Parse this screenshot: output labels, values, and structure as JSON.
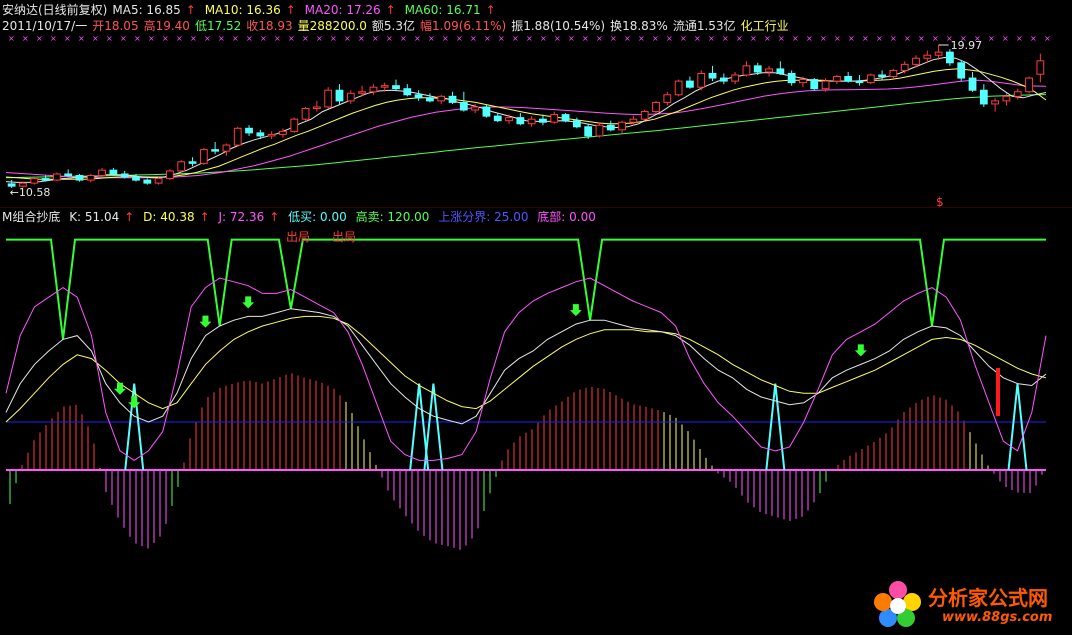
{
  "header1": {
    "title": "安纳达(日线前复权)",
    "ma5": "MA5: 16.85",
    "ma10": "MA10: 16.36",
    "ma20": "MA20: 17.26",
    "ma60": "MA60: 16.71",
    "up_arrow": "↑"
  },
  "header2": {
    "date": "2011/10/17/一",
    "open": "开18.05",
    "high": "高19.40",
    "low": "低17.52",
    "close": "收18.93",
    "volume": "量288200.0",
    "amount": "额5.3亿",
    "change": "幅1.09(6.11%)",
    "amplitude": "振1.88(10.54%)",
    "turnover": "换18.83%",
    "float_shares": "流通1.53亿",
    "industry": "化工行业"
  },
  "header3": {
    "indicator": "M组合抄底",
    "k": "K: 51.04",
    "d": "D: 40.38",
    "j": "J: 72.36",
    "low_buy": "低买: 0.00",
    "high_sell": "高卖: 120.00",
    "up_boundary": "上涨分界: 25.00",
    "bottom": "底部: 0.00"
  },
  "annotations": {
    "high_label": "19.97",
    "low_label": "10.58",
    "exit1": "出局",
    "exit2": "出局",
    "s_mark": "$"
  },
  "logo": {
    "text": "分析家公式网",
    "url": "www.88gs.com"
  },
  "colors": {
    "background": "#000000",
    "up_candle": "#ff3c3c",
    "down_candle": "#54ffff",
    "ma5": "#e6e6e6",
    "ma10": "#ffff54",
    "ma20": "#ff54ff",
    "ma60": "#54ff54",
    "top_signal": "#33ff33",
    "bottom_signal": "#54ffff",
    "boundary_line": "#2020ff",
    "zero_line": "#ff54ff"
  },
  "chart_data": {
    "type": "candlestick",
    "price_range": [
      10.58,
      19.97
    ],
    "candles": [
      {
        "o": 10.85,
        "h": 11.1,
        "l": 10.58,
        "c": 10.7
      },
      {
        "o": 10.7,
        "h": 11.0,
        "l": 10.6,
        "c": 10.9
      },
      {
        "o": 10.9,
        "h": 11.3,
        "l": 10.8,
        "c": 11.2
      },
      {
        "o": 11.2,
        "h": 11.4,
        "l": 11.0,
        "c": 11.1
      },
      {
        "o": 11.1,
        "h": 11.6,
        "l": 11.05,
        "c": 11.5
      },
      {
        "o": 11.5,
        "h": 11.8,
        "l": 11.3,
        "c": 11.4
      },
      {
        "o": 11.4,
        "h": 11.5,
        "l": 11.0,
        "c": 11.1
      },
      {
        "o": 11.1,
        "h": 11.5,
        "l": 10.95,
        "c": 11.4
      },
      {
        "o": 11.4,
        "h": 11.9,
        "l": 11.3,
        "c": 11.75
      },
      {
        "o": 11.75,
        "h": 11.9,
        "l": 11.4,
        "c": 11.5
      },
      {
        "o": 11.5,
        "h": 11.7,
        "l": 11.2,
        "c": 11.3
      },
      {
        "o": 11.3,
        "h": 11.5,
        "l": 11.0,
        "c": 11.1
      },
      {
        "o": 11.1,
        "h": 11.2,
        "l": 10.8,
        "c": 10.9
      },
      {
        "o": 10.9,
        "h": 11.3,
        "l": 10.8,
        "c": 11.2
      },
      {
        "o": 11.2,
        "h": 11.8,
        "l": 11.1,
        "c": 11.7
      },
      {
        "o": 11.7,
        "h": 12.4,
        "l": 11.6,
        "c": 12.3
      },
      {
        "o": 12.3,
        "h": 12.6,
        "l": 12.0,
        "c": 12.2
      },
      {
        "o": 12.2,
        "h": 13.2,
        "l": 12.1,
        "c": 13.1
      },
      {
        "o": 13.1,
        "h": 13.6,
        "l": 12.8,
        "c": 13.0
      },
      {
        "o": 13.0,
        "h": 13.5,
        "l": 12.7,
        "c": 13.4
      },
      {
        "o": 13.4,
        "h": 14.6,
        "l": 13.3,
        "c": 14.5
      },
      {
        "o": 14.5,
        "h": 14.7,
        "l": 14.0,
        "c": 14.2
      },
      {
        "o": 14.2,
        "h": 14.4,
        "l": 13.8,
        "c": 14.0
      },
      {
        "o": 14.0,
        "h": 14.3,
        "l": 13.8,
        "c": 14.1
      },
      {
        "o": 14.1,
        "h": 14.5,
        "l": 13.9,
        "c": 14.3
      },
      {
        "o": 14.3,
        "h": 15.2,
        "l": 14.2,
        "c": 15.1
      },
      {
        "o": 15.1,
        "h": 15.9,
        "l": 15.0,
        "c": 15.8
      },
      {
        "o": 15.8,
        "h": 16.3,
        "l": 15.6,
        "c": 15.9
      },
      {
        "o": 15.9,
        "h": 17.2,
        "l": 15.8,
        "c": 17.0
      },
      {
        "o": 17.0,
        "h": 17.4,
        "l": 16.1,
        "c": 16.3
      },
      {
        "o": 16.3,
        "h": 17.0,
        "l": 16.1,
        "c": 16.8
      },
      {
        "o": 16.8,
        "h": 17.3,
        "l": 16.6,
        "c": 16.9
      },
      {
        "o": 16.9,
        "h": 17.4,
        "l": 16.7,
        "c": 17.2
      },
      {
        "o": 17.2,
        "h": 17.5,
        "l": 16.9,
        "c": 17.3
      },
      {
        "o": 17.3,
        "h": 17.7,
        "l": 17.0,
        "c": 17.1
      },
      {
        "o": 17.1,
        "h": 17.4,
        "l": 16.6,
        "c": 16.7
      },
      {
        "o": 16.7,
        "h": 17.0,
        "l": 16.3,
        "c": 16.5
      },
      {
        "o": 16.5,
        "h": 16.8,
        "l": 16.2,
        "c": 16.3
      },
      {
        "o": 16.3,
        "h": 16.7,
        "l": 16.1,
        "c": 16.6
      },
      {
        "o": 16.6,
        "h": 16.9,
        "l": 16.1,
        "c": 16.2
      },
      {
        "o": 16.2,
        "h": 16.9,
        "l": 15.6,
        "c": 15.7
      },
      {
        "o": 15.7,
        "h": 16.1,
        "l": 15.5,
        "c": 15.9
      },
      {
        "o": 15.9,
        "h": 16.1,
        "l": 15.2,
        "c": 15.3
      },
      {
        "o": 15.3,
        "h": 15.5,
        "l": 14.9,
        "c": 15.0
      },
      {
        "o": 15.0,
        "h": 15.4,
        "l": 14.8,
        "c": 15.2
      },
      {
        "o": 15.2,
        "h": 15.5,
        "l": 14.7,
        "c": 14.8
      },
      {
        "o": 14.8,
        "h": 15.3,
        "l": 14.6,
        "c": 15.1
      },
      {
        "o": 15.1,
        "h": 15.4,
        "l": 14.7,
        "c": 14.9
      },
      {
        "o": 14.9,
        "h": 15.6,
        "l": 14.8,
        "c": 15.4
      },
      {
        "o": 15.4,
        "h": 15.5,
        "l": 14.9,
        "c": 15.0
      },
      {
        "o": 15.0,
        "h": 15.2,
        "l": 14.5,
        "c": 14.6
      },
      {
        "o": 14.6,
        "h": 14.8,
        "l": 13.8,
        "c": 14.0
      },
      {
        "o": 14.0,
        "h": 14.9,
        "l": 13.9,
        "c": 14.7
      },
      {
        "o": 14.7,
        "h": 15.0,
        "l": 14.3,
        "c": 14.4
      },
      {
        "o": 14.4,
        "h": 15.0,
        "l": 14.2,
        "c": 14.9
      },
      {
        "o": 14.9,
        "h": 15.3,
        "l": 14.7,
        "c": 15.1
      },
      {
        "o": 15.1,
        "h": 15.7,
        "l": 15.0,
        "c": 15.6
      },
      {
        "o": 15.6,
        "h": 16.3,
        "l": 15.5,
        "c": 16.2
      },
      {
        "o": 16.2,
        "h": 16.9,
        "l": 16.0,
        "c": 16.7
      },
      {
        "o": 16.7,
        "h": 17.7,
        "l": 16.6,
        "c": 17.6
      },
      {
        "o": 17.6,
        "h": 17.9,
        "l": 17.1,
        "c": 17.2
      },
      {
        "o": 17.2,
        "h": 18.3,
        "l": 17.0,
        "c": 18.1
      },
      {
        "o": 18.1,
        "h": 18.6,
        "l": 17.6,
        "c": 17.8
      },
      {
        "o": 17.8,
        "h": 18.1,
        "l": 17.4,
        "c": 17.6
      },
      {
        "o": 17.6,
        "h": 18.2,
        "l": 17.4,
        "c": 18.0
      },
      {
        "o": 18.0,
        "h": 18.9,
        "l": 17.9,
        "c": 18.6
      },
      {
        "o": 18.6,
        "h": 18.8,
        "l": 18.0,
        "c": 18.2
      },
      {
        "o": 18.2,
        "h": 18.6,
        "l": 17.9,
        "c": 18.4
      },
      {
        "o": 18.4,
        "h": 18.9,
        "l": 18.0,
        "c": 18.1
      },
      {
        "o": 18.1,
        "h": 18.3,
        "l": 17.3,
        "c": 17.5
      },
      {
        "o": 17.5,
        "h": 17.9,
        "l": 17.2,
        "c": 17.7
      },
      {
        "o": 17.7,
        "h": 17.8,
        "l": 17.0,
        "c": 17.1
      },
      {
        "o": 17.1,
        "h": 17.8,
        "l": 16.9,
        "c": 17.6
      },
      {
        "o": 17.6,
        "h": 18.0,
        "l": 17.4,
        "c": 17.9
      },
      {
        "o": 17.9,
        "h": 18.2,
        "l": 17.5,
        "c": 17.6
      },
      {
        "o": 17.6,
        "h": 18.0,
        "l": 17.3,
        "c": 17.5
      },
      {
        "o": 17.5,
        "h": 18.1,
        "l": 17.4,
        "c": 18.0
      },
      {
        "o": 18.0,
        "h": 18.3,
        "l": 17.7,
        "c": 17.9
      },
      {
        "o": 17.9,
        "h": 18.4,
        "l": 17.8,
        "c": 18.3
      },
      {
        "o": 18.3,
        "h": 18.9,
        "l": 18.1,
        "c": 18.7
      },
      {
        "o": 18.7,
        "h": 19.3,
        "l": 18.5,
        "c": 19.1
      },
      {
        "o": 19.1,
        "h": 19.6,
        "l": 18.8,
        "c": 19.3
      },
      {
        "o": 19.3,
        "h": 19.97,
        "l": 19.0,
        "c": 19.5
      },
      {
        "o": 19.5,
        "h": 19.7,
        "l": 18.6,
        "c": 18.8
      },
      {
        "o": 18.8,
        "h": 19.0,
        "l": 17.6,
        "c": 17.8
      },
      {
        "o": 17.8,
        "h": 18.2,
        "l": 16.9,
        "c": 17.0
      },
      {
        "o": 17.0,
        "h": 17.4,
        "l": 15.9,
        "c": 16.1
      },
      {
        "o": 16.1,
        "h": 16.5,
        "l": 15.6,
        "c": 16.3
      },
      {
        "o": 16.3,
        "h": 16.8,
        "l": 16.0,
        "c": 16.6
      },
      {
        "o": 16.6,
        "h": 17.1,
        "l": 16.4,
        "c": 16.9
      },
      {
        "o": 16.9,
        "h": 17.9,
        "l": 16.8,
        "c": 17.8
      },
      {
        "o": 18.05,
        "h": 19.4,
        "l": 17.52,
        "c": 18.93
      }
    ],
    "ma5": [
      11.0,
      10.95,
      10.95,
      11.0,
      11.1,
      11.2,
      11.25,
      11.3,
      11.35,
      11.45,
      11.45,
      11.4,
      11.3,
      11.25,
      11.3,
      11.5,
      11.75,
      12.1,
      12.45,
      12.8,
      13.2,
      13.5,
      13.75,
      13.95,
      14.15,
      14.45,
      14.8,
      15.1,
      15.6,
      15.9,
      16.2,
      16.5,
      16.8,
      16.95,
      17.0,
      16.95,
      16.85,
      16.7,
      16.55,
      16.45,
      16.2,
      16.05,
      15.85,
      15.6,
      15.4,
      15.2,
      15.0,
      14.95,
      14.95,
      15.0,
      14.95,
      14.85,
      14.7,
      14.6,
      14.55,
      14.6,
      14.8,
      15.2,
      15.6,
      16.1,
      16.5,
      16.95,
      17.3,
      17.6,
      17.8,
      17.95,
      18.05,
      18.15,
      18.15,
      18.0,
      17.85,
      17.7,
      17.6,
      17.6,
      17.6,
      17.6,
      17.65,
      17.75,
      17.9,
      18.1,
      18.4,
      18.7,
      19.0,
      19.15,
      19.1,
      18.8,
      18.3,
      17.7,
      17.1,
      16.6,
      16.5,
      16.7,
      16.85
    ],
    "ma10": [
      11.3,
      11.25,
      11.2,
      11.15,
      11.15,
      11.15,
      11.15,
      11.15,
      11.2,
      11.25,
      11.3,
      11.32,
      11.32,
      11.3,
      11.3,
      11.35,
      11.45,
      11.6,
      11.8,
      12.0,
      12.3,
      12.6,
      12.9,
      13.2,
      13.45,
      13.75,
      14.05,
      14.3,
      14.6,
      14.9,
      15.2,
      15.5,
      15.75,
      16.0,
      16.2,
      16.35,
      16.45,
      16.5,
      16.5,
      16.45,
      16.4,
      16.3,
      16.2,
      16.05,
      15.9,
      15.75,
      15.6,
      15.45,
      15.35,
      15.25,
      15.15,
      15.05,
      14.95,
      14.85,
      14.8,
      14.8,
      14.85,
      14.95,
      15.1,
      15.35,
      15.6,
      15.9,
      16.2,
      16.5,
      16.75,
      17.0,
      17.2,
      17.35,
      17.5,
      17.6,
      17.65,
      17.65,
      17.65,
      17.65,
      17.6,
      17.6,
      17.6,
      17.62,
      17.65,
      17.7,
      17.8,
      17.95,
      18.1,
      18.25,
      18.35,
      18.4,
      18.35,
      18.25,
      18.05,
      17.85,
      17.6,
      17.3,
      16.9,
      16.36
    ],
    "ma20": [
      11.6,
      11.55,
      11.5,
      11.45,
      11.4,
      11.35,
      11.3,
      11.28,
      11.26,
      11.25,
      11.25,
      11.25,
      11.25,
      11.26,
      11.28,
      11.3,
      11.35,
      11.4,
      11.5,
      11.6,
      11.75,
      11.9,
      12.05,
      12.25,
      12.45,
      12.65,
      12.9,
      13.15,
      13.4,
      13.65,
      13.9,
      14.15,
      14.4,
      14.65,
      14.85,
      15.05,
      15.25,
      15.4,
      15.55,
      15.65,
      15.75,
      15.82,
      15.88,
      15.9,
      15.9,
      15.88,
      15.85,
      15.8,
      15.75,
      15.7,
      15.65,
      15.6,
      15.55,
      15.5,
      15.45,
      15.42,
      15.4,
      15.42,
      15.45,
      15.5,
      15.6,
      15.72,
      15.85,
      16.0,
      16.15,
      16.3,
      16.45,
      16.6,
      16.72,
      16.82,
      16.9,
      16.96,
      17.0,
      17.02,
      17.03,
      17.04,
      17.05,
      17.06,
      17.08,
      17.12,
      17.18,
      17.26,
      17.35,
      17.45,
      17.55,
      17.62,
      17.65,
      17.6,
      17.5,
      17.4,
      17.3,
      17.28,
      17.26
    ],
    "ma60": [
      11.25,
      11.27,
      11.29,
      11.3,
      11.32,
      11.33,
      11.35,
      11.36,
      11.37,
      11.38,
      11.4,
      11.42,
      11.44,
      11.46,
      11.48,
      11.5,
      11.53,
      11.56,
      11.6,
      11.64,
      11.68,
      11.73,
      11.78,
      11.84,
      11.9,
      11.96,
      12.02,
      12.08,
      12.15,
      12.22,
      12.3,
      12.38,
      12.46,
      12.54,
      12.62,
      12.7,
      12.78,
      12.86,
      12.94,
      13.02,
      13.1,
      13.18,
      13.25,
      13.32,
      13.4,
      13.47,
      13.54,
      13.61,
      13.68,
      13.75,
      13.82,
      13.89,
      13.96,
      14.03,
      14.1,
      14.17,
      14.24,
      14.31,
      14.38,
      14.46,
      14.54,
      14.62,
      14.7,
      14.78,
      14.86,
      14.94,
      15.02,
      15.1,
      15.18,
      15.26,
      15.34,
      15.42,
      15.5,
      15.58,
      15.66,
      15.74,
      15.82,
      15.9,
      15.98,
      16.06,
      16.14,
      16.22,
      16.3,
      16.38,
      16.45,
      16.5,
      16.55,
      16.6,
      16.63,
      16.66,
      16.68,
      16.7,
      16.71
    ],
    "indicator_range": [
      -50,
      125
    ],
    "k": [
      30,
      45,
      55,
      62,
      68,
      70,
      62,
      45,
      35,
      28,
      25,
      28,
      40,
      58,
      70,
      75,
      78,
      80,
      80,
      82,
      84,
      83,
      82,
      80,
      75,
      65,
      55,
      45,
      38,
      32,
      28,
      26,
      24,
      28,
      40,
      52,
      58,
      62,
      68,
      72,
      76,
      78,
      78,
      76,
      74,
      73,
      72,
      70,
      65,
      58,
      52,
      48,
      42,
      38,
      36,
      34,
      35,
      40,
      48,
      52,
      55,
      58,
      62,
      68,
      72,
      75,
      74,
      70,
      62,
      54,
      48,
      45,
      44,
      50
    ],
    "d": [
      25,
      32,
      40,
      48,
      55,
      60,
      58,
      52,
      45,
      40,
      35,
      32,
      35,
      45,
      55,
      62,
      68,
      72,
      75,
      77,
      79,
      80,
      80,
      79,
      76,
      70,
      63,
      56,
      49,
      44,
      40,
      36,
      33,
      32,
      36,
      42,
      48,
      54,
      59,
      64,
      68,
      71,
      73,
      73,
      73,
      72,
      72,
      71,
      68,
      64,
      60,
      55,
      51,
      47,
      44,
      41,
      40,
      40,
      43,
      46,
      49,
      52,
      56,
      60,
      64,
      68,
      69,
      68,
      65,
      61,
      57,
      53,
      50,
      48
    ],
    "j": [
      40,
      70,
      85,
      90,
      95,
      90,
      70,
      30,
      10,
      5,
      10,
      20,
      50,
      85,
      95,
      100,
      98,
      96,
      92,
      92,
      94,
      90,
      86,
      82,
      72,
      55,
      35,
      15,
      8,
      5,
      5,
      6,
      8,
      20,
      48,
      72,
      82,
      88,
      92,
      95,
      98,
      100,
      96,
      92,
      88,
      85,
      82,
      75,
      58,
      45,
      35,
      28,
      20,
      12,
      10,
      12,
      25,
      42,
      60,
      68,
      72,
      76,
      82,
      88,
      92,
      95,
      90,
      78,
      55,
      35,
      15,
      10,
      30,
      70
    ],
    "high_sell_signal_base": 120,
    "low_buy_level": 0,
    "up_boundary": 25,
    "bottom_level": 0
  }
}
